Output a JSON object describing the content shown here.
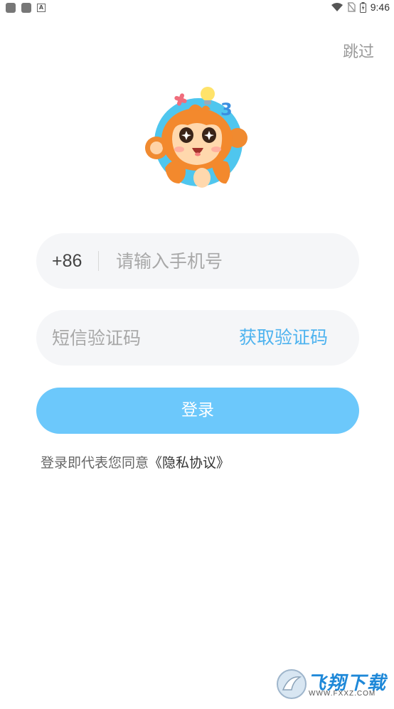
{
  "status_bar": {
    "time": "9:46"
  },
  "header": {
    "skip_label": "跳过"
  },
  "phone_field": {
    "prefix": "+86",
    "placeholder": "请输入手机号"
  },
  "code_field": {
    "placeholder": "短信验证码",
    "get_code_label": "获取验证码"
  },
  "login_button": {
    "label": "登录",
    "color": "#6cc8fb"
  },
  "agreement": {
    "text": "登录即代表您同意",
    "link": "《隐私协议》"
  },
  "watermark": {
    "text": "飞翔下载",
    "url": "WWW.FXXZ.COM"
  },
  "colors": {
    "accent": "#4eb3ef",
    "field_bg": "#f5f6f8"
  }
}
